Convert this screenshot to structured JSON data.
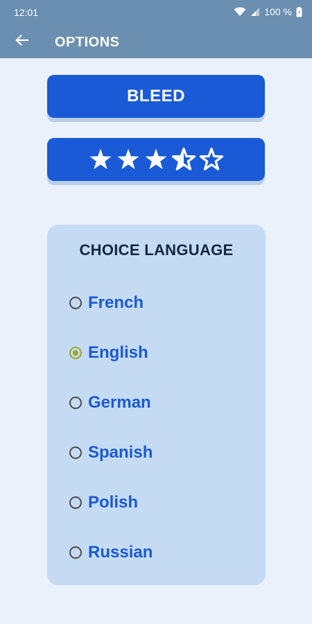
{
  "status_bar": {
    "time": "12:01",
    "battery_text": "100 %",
    "icons": [
      "wifi-icon",
      "signal-icon",
      "battery-icon"
    ]
  },
  "app_bar": {
    "title": "OPTIONS",
    "back_icon": "arrow-left-icon",
    "background": "#6b8fb0"
  },
  "buttons": {
    "bleed_label": "BLEED",
    "rating": {
      "value": 3.5,
      "max": 5,
      "icon": "star-icon"
    }
  },
  "language": {
    "title": "CHOICE LANGUAGE",
    "options": [
      {
        "label": "French",
        "selected": false
      },
      {
        "label": "English",
        "selected": true
      },
      {
        "label": "German",
        "selected": false
      },
      {
        "label": "Spanish",
        "selected": false
      },
      {
        "label": "Polish",
        "selected": false
      },
      {
        "label": "Russian",
        "selected": false
      }
    ]
  },
  "colors": {
    "accent": "#1a5ad7",
    "page_background": "#eaf1fb",
    "card_background": "#c5dbf3",
    "radio_selected": "#9aa82a"
  }
}
